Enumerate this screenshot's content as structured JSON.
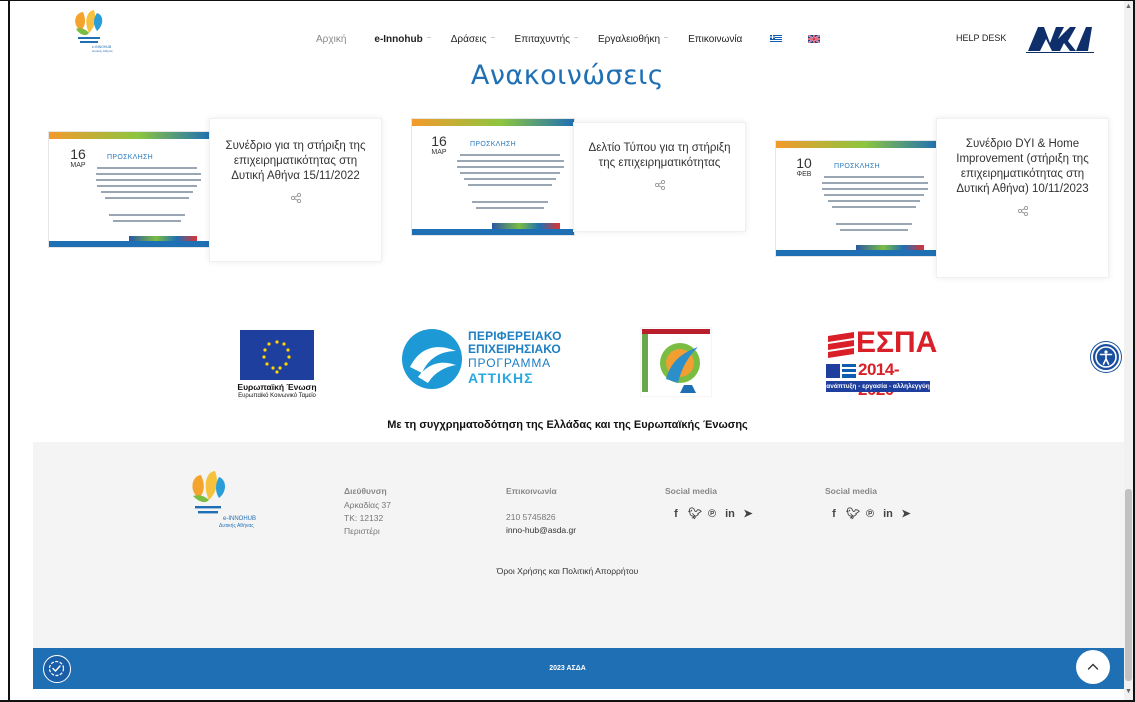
{
  "nav": {
    "items": [
      "Αρχική",
      "e-Innohub",
      "Δράσεις",
      "Επιταχυντής",
      "Εργαλειοθήκη",
      "Επικοινωνία"
    ],
    "helpdesk": "HELP DESK"
  },
  "page": {
    "title": "Ανακοινώσεις"
  },
  "cards": [
    {
      "day": "16",
      "month": "ΜΑΡ",
      "poster_heading": "ΠΡΟΣΚΛΗΣΗ",
      "title": "Συνέδριο για τη στήριξη της επιχειρηματικότητας στη Δυτική Αθήνα 15/11/2022"
    },
    {
      "day": "16",
      "month": "ΜΑΡ",
      "poster_heading": "ΠΡΟΣΚΛΗΣΗ",
      "title": "Δελτίο Τύπου για τη στήριξη της επιχειρηματικότητας"
    },
    {
      "day": "10",
      "month": "ΦΕΒ",
      "poster_heading": "ΠΡΟΣΚΛΗΣΗ",
      "title": "Συνέδριο DYI & Home Improvement (στήριξη της επιχειρηματικότητας στη Δυτική Αθήνα) 10/11/2023"
    }
  ],
  "sponsors": {
    "eu_name": "Ευρωπαϊκή Ένωση",
    "eu_fund": "Ευρωπαϊκό Κοινωνικό Ταμείο",
    "pep_line1": "ΠΕΡΙΦΕΡΕΙΑΚΟ",
    "pep_line2": "ΕΠΙΧΕΙΡΗΣΙΑΚΟ",
    "pep_line3": "ΠΡΟΓΡΑΜΜΑ",
    "pep_line4": "ΑΤΤΙΚΗΣ",
    "espa_title": "ΕΣΠΑ",
    "espa_years": "2014-2020",
    "espa_slogan": "ανάπτυξη - εργασία - αλληλεγγύη",
    "funding_text": "Με τη συγχρηματοδότηση της Ελλάδας και της Ευρωπαϊκής Ένωσης"
  },
  "footer": {
    "logo_line1": "e-INNOHUB",
    "logo_line2": "Δυτικής Αθήνας",
    "address_heading": "Διεύθυνση",
    "address_lines": [
      "Αρκαδίας 37",
      "ΤΚ: 12132",
      "Περιστέρι"
    ],
    "contact_heading": "Επικοινωνία",
    "phone": "210 5745826",
    "email": "inno-hub@asda.gr",
    "social_heading_1": "Social media",
    "social_heading_2": "Social media",
    "social_icons": [
      "facebook-icon",
      "twitter-icon",
      "pinterest-icon",
      "linkedin-icon",
      "telegram-icon"
    ],
    "terms": "Όροι Χρήσης και Πολιτική Απορρήτου",
    "copyright": "2023 ΑΣΔΑ"
  },
  "colors": {
    "primary_blue": "#1f6fb5",
    "footer_bg": "#f4f4f4"
  }
}
